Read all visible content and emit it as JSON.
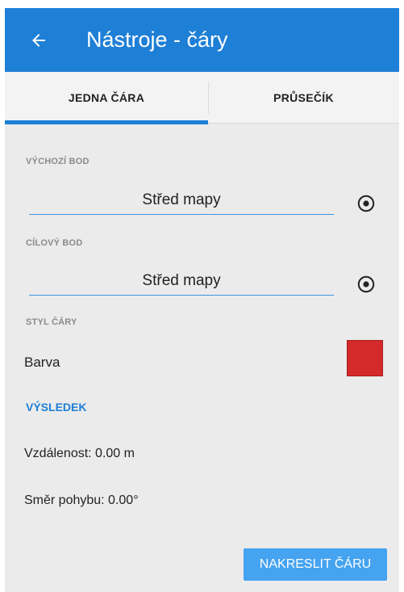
{
  "appbar": {
    "title": "Nástroje - čáry",
    "back_icon": "arrow-left-icon"
  },
  "tabs": [
    {
      "label": "JEDNA ČÁRA",
      "active": true
    },
    {
      "label": "PRŮSEČÍK",
      "active": false
    }
  ],
  "start_point": {
    "label": "VÝCHOZÍ BOD",
    "value": "Střed mapy",
    "icon": "target-icon"
  },
  "end_point": {
    "label": "CÍLOVÝ BOD",
    "value": "Střed mapy",
    "icon": "target-icon"
  },
  "line_style": {
    "label": "STYL ČÁRY",
    "color_label": "Barva",
    "color": "#d42a2a"
  },
  "result": {
    "header": "VÝSLEDEK",
    "distance": "Vzdálenost: 0.00 m",
    "bearing": "Směr pohybu: 0.00°"
  },
  "action": {
    "label": "NAKRESLIT ČÁRU"
  },
  "colors": {
    "accent": "#1e7fd6",
    "button": "#45a3f0",
    "background": "#ebebeb"
  }
}
